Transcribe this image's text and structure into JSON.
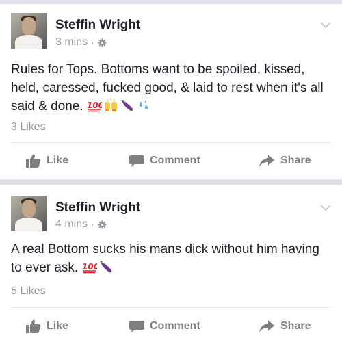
{
  "posts": [
    {
      "author": "Steffin Wright",
      "time": "3 mins",
      "separator": "·",
      "text": "Rules for Tops. Bottoms want to be spoiled, kissed, held, caressed, fucked good, & laid to rest when it's all said & done.",
      "emojis": [
        "hundred-points-emoji",
        "raising-hands-emoji",
        "eggplant-emoji",
        "sweat-droplets-emoji"
      ],
      "likes": "3 Likes",
      "actions": {
        "like": "Like",
        "comment": "Comment",
        "share": "Share"
      }
    },
    {
      "author": "Steffin Wright",
      "time": "4 mins",
      "separator": "·",
      "text": "A real Bottom sucks his mans dick without him having to ever ask.",
      "emojis": [
        "hundred-points-emoji",
        "eggplant-emoji"
      ],
      "likes": "5 Likes",
      "actions": {
        "like": "Like",
        "comment": "Comment",
        "share": "Share"
      }
    }
  ],
  "colors": {
    "background": "#dfe1e6",
    "card": "#ffffff",
    "name": "#1d2129",
    "meta": "#90949c",
    "action": "#7f7f7f"
  }
}
